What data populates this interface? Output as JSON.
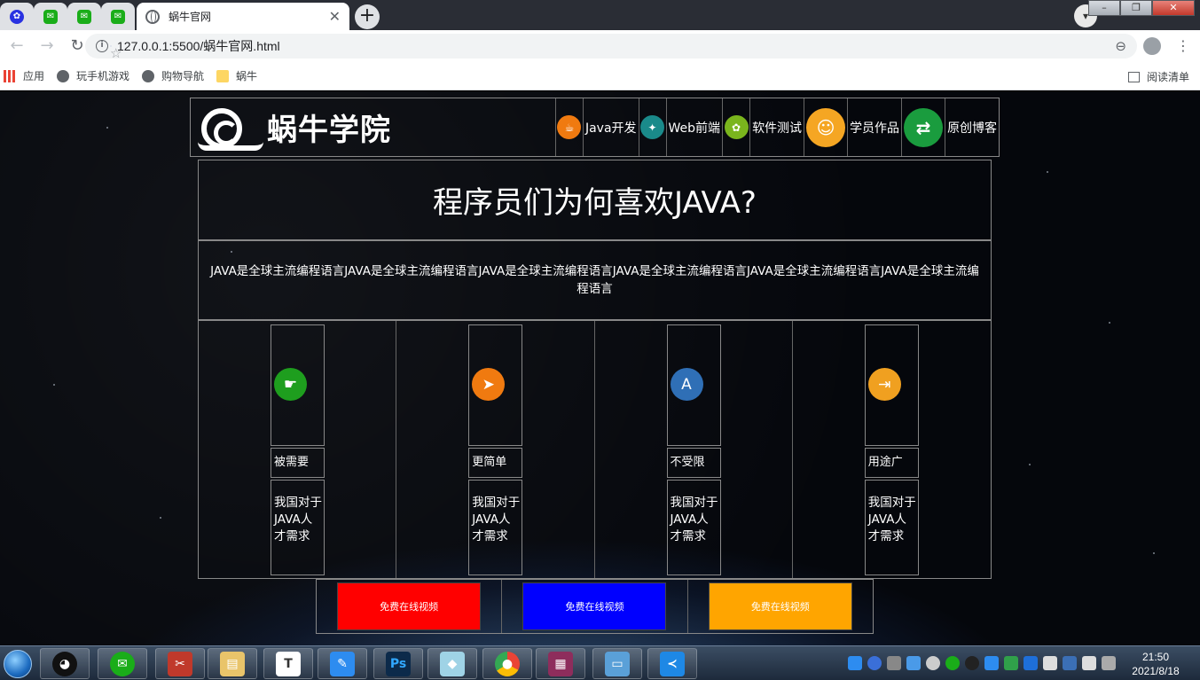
{
  "browser": {
    "tab_title": "蜗牛官网",
    "url": "127.0.0.1:5500/蜗牛官网.html",
    "bookmarks": [
      "应用",
      "玩手机游戏",
      "购物导航",
      "蜗牛"
    ],
    "reading_list": "阅读清单"
  },
  "site": {
    "logo_text": "蜗牛学院",
    "nav": [
      "Java开发",
      "Web前端",
      "软件测试",
      "学员作品",
      "原创博客"
    ],
    "headline": "程序员们为何喜欢JAVA?",
    "description": "JAVA是全球主流编程语言JAVA是全球主流编程语言JAVA是全球主流编程语言JAVA是全球主流编程语言JAVA是全球主流编程语言JAVA是全球主流编程语言",
    "features": [
      {
        "name": "被需要",
        "desc": "我国对于JAVA人才需求",
        "icon": "hand-pointer-icon",
        "color": "#1e9e1e"
      },
      {
        "name": "更简单",
        "desc": "我国对于JAVA人才需求",
        "icon": "paper-plane-icon",
        "color": "#f07a10"
      },
      {
        "name": "不受限",
        "desc": "我国对于JAVA人才需求",
        "icon": "app-store-icon",
        "color": "#2f6fb6"
      },
      {
        "name": "用途广",
        "desc": "我国对于JAVA人才需求",
        "icon": "sign-in-icon",
        "color": "#f0a020"
      }
    ],
    "video_buttons": [
      {
        "label": "免费在线视频",
        "color": "#ff0000"
      },
      {
        "label": "免费在线视频",
        "color": "#0000ff"
      },
      {
        "label": "免费在线视频",
        "color": "#ffa500"
      }
    ]
  },
  "taskbar": {
    "time": "21:50",
    "date": "2021/8/18"
  }
}
